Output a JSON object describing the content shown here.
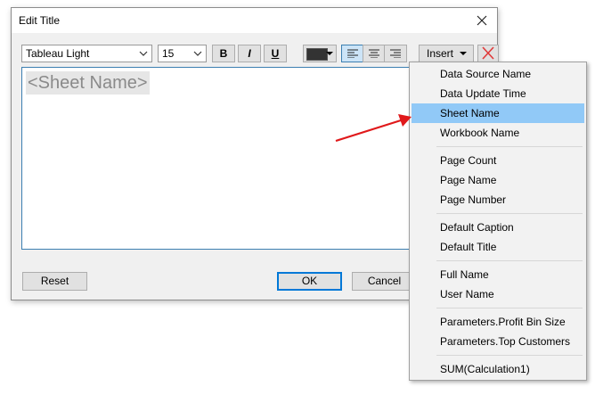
{
  "dialog": {
    "title": "Edit Title",
    "close_icon": "close-icon",
    "toolbar": {
      "font": "Tableau Light",
      "size": "15",
      "bold": "B",
      "italic": "I",
      "underline": "U",
      "color": "#333333",
      "insert_label": "Insert",
      "align_icons": [
        "align-left-icon",
        "align-center-icon",
        "align-right-icon"
      ],
      "active_align": "left",
      "delete_icon": "delete-x-icon",
      "delete_color": "#e03a3a"
    },
    "editor": {
      "content": "<Sheet Name>"
    },
    "buttons": {
      "reset": "Reset",
      "ok": "OK",
      "cancel": "Cancel"
    }
  },
  "insert_menu": {
    "highlighted": "Sheet Name",
    "groups": [
      [
        "Data Source Name",
        "Data Update Time",
        "Sheet Name",
        "Workbook Name"
      ],
      [
        "Page Count",
        "Page Name",
        "Page Number"
      ],
      [
        "Default Caption",
        "Default Title"
      ],
      [
        "Full Name",
        "User Name"
      ],
      [
        "Parameters.Profit Bin Size",
        "Parameters.Top Customers"
      ],
      [
        "SUM(Calculation1)"
      ]
    ],
    "highlight_color": "#91c9f7"
  },
  "annotation": {
    "arrow_color": "#e0191b"
  }
}
